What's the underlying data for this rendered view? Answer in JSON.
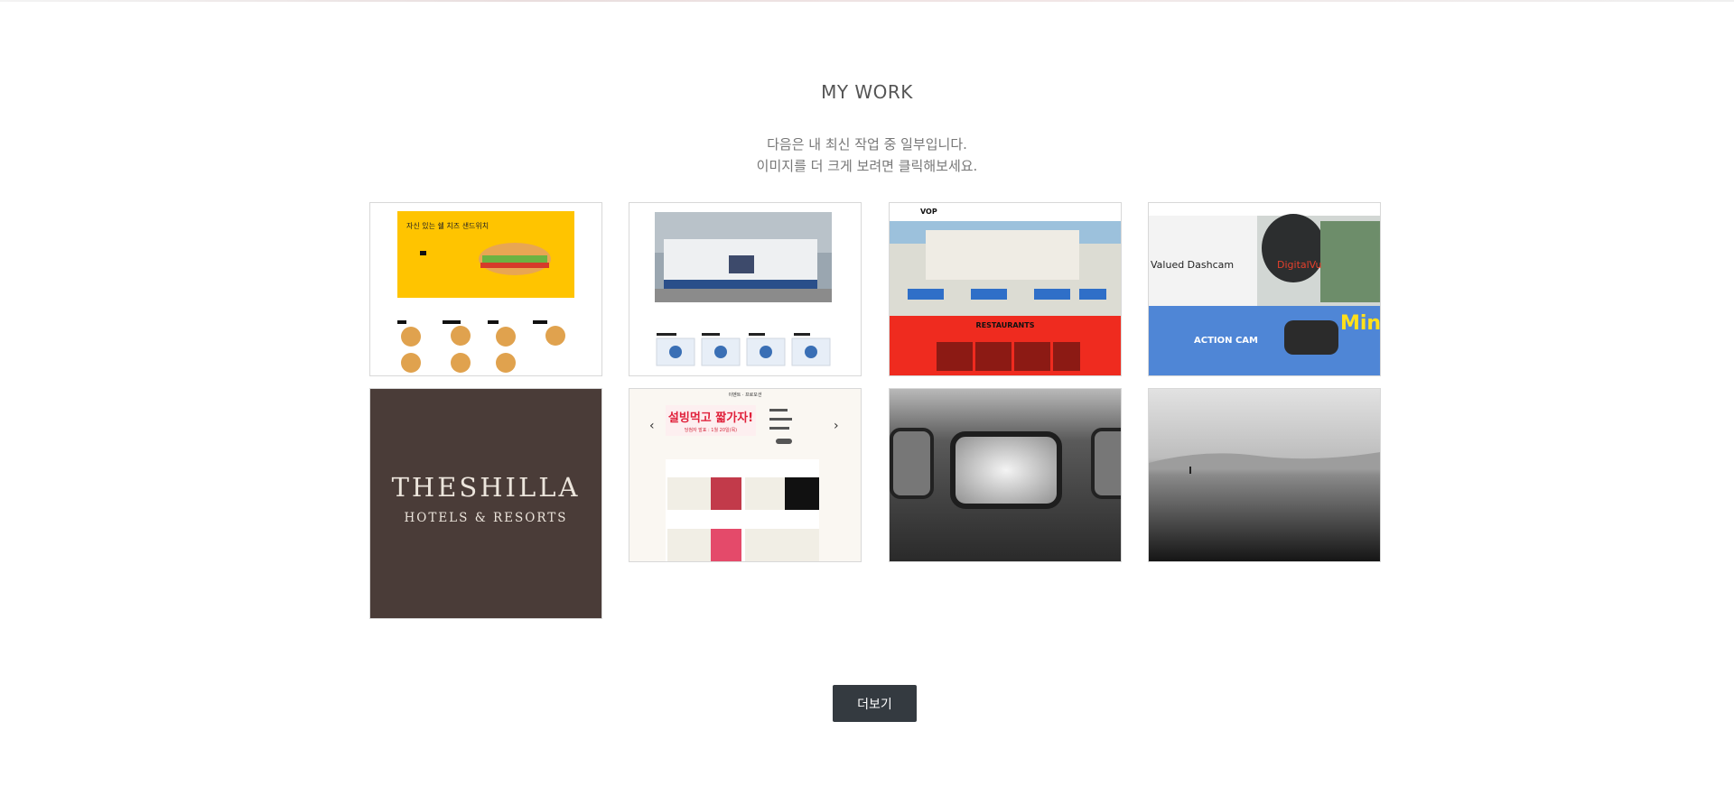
{
  "section": {
    "title": "MY WORK",
    "subtitle_line1": "다음은 내 최신 작업 중 일부입니다.",
    "subtitle_line2": "이미지를 더 크게 보려면 클릭해보세요."
  },
  "thumbnails": [
    {
      "caption": "자신 있는 쉘 치즈 샌드위치"
    },
    {
      "caption": ""
    },
    {
      "caption": "RESTAURANTS",
      "logo": "VOP"
    },
    {
      "caption": "Valued Dashcam",
      "highlight": "DigitalVu",
      "sub": "ACTION CAM",
      "corner": "Mini"
    },
    {
      "logo_line1": "THESHILLA",
      "logo_line2": "HOTELS & RESORTS"
    },
    {
      "header": "이벤트 · 프로모션",
      "banner": "설빙먹고 짧가자!",
      "banner_sub": "당첨자 발표 : 1월 20일(목)"
    },
    {
      "caption": ""
    },
    {
      "caption": ""
    }
  ],
  "actions": {
    "more_label": "더보기"
  },
  "colors": {
    "button_bg": "#343a40",
    "subway_yellow": "#ffc400",
    "vop_red": "#ef2b1f",
    "shilla_brown": "#4a3c38"
  }
}
